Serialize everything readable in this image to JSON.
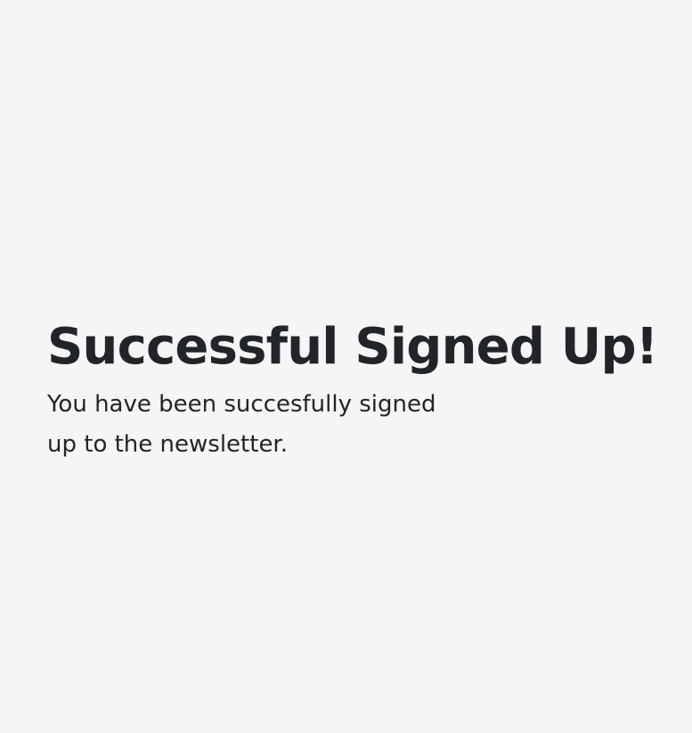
{
  "confirmation": {
    "title": "Successful Signed Up!",
    "message": "You have been succesfully signed up to the newsletter."
  },
  "colors": {
    "background": "#f5f5f5",
    "text": "#212529"
  }
}
